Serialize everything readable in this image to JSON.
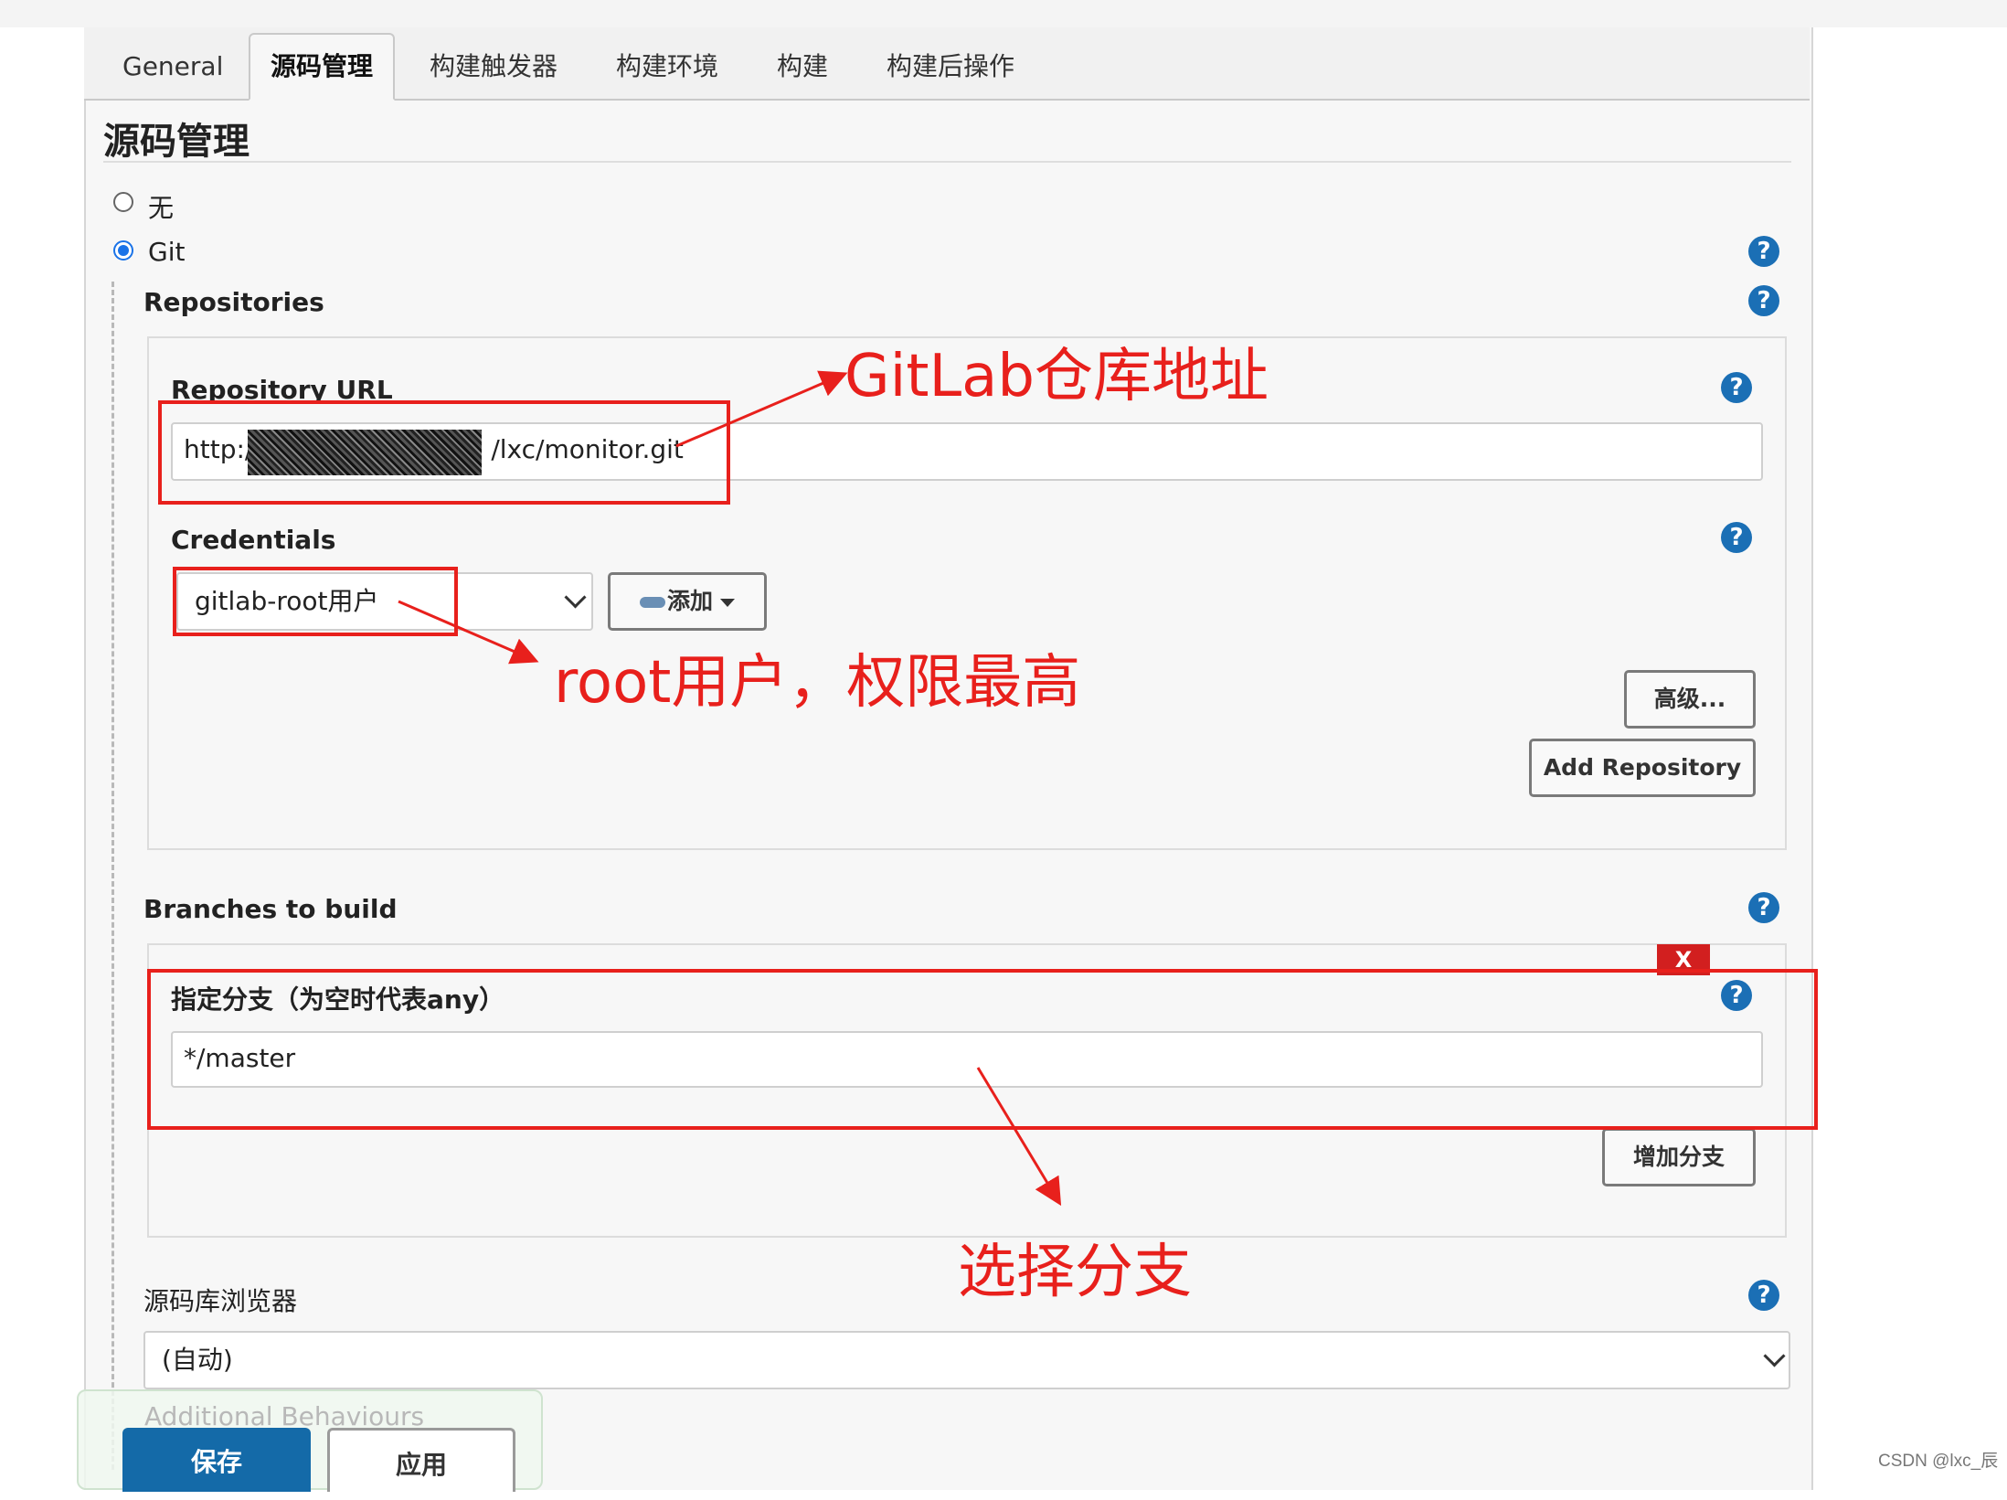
{
  "tabs": [
    "General",
    "源码管理",
    "构建触发器",
    "构建环境",
    "构建",
    "构建后操作"
  ],
  "section_title": "源码管理",
  "scm_options": {
    "none": "无",
    "git": "Git"
  },
  "repositories": {
    "label": "Repositories",
    "url_label": "Repository URL",
    "url_prefix": "http:/",
    "url_suffix": "/lxc/monitor.git",
    "credentials_label": "Credentials",
    "credentials_value": "gitlab-root用户",
    "add_button": "添加",
    "advanced_button": "高级...",
    "add_repository_button": "Add Repository"
  },
  "branches": {
    "label": "Branches to build",
    "delete": "X",
    "specifier_label": "指定分支（为空时代表any）",
    "specifier_value": "*/master",
    "add_branch_button": "增加分支"
  },
  "browser": {
    "label": "源码库浏览器",
    "value": "(自动)"
  },
  "additional_behaviours": "Additional Behaviours",
  "footer": {
    "save": "保存",
    "apply": "应用"
  },
  "annotations": {
    "gitlab": "GitLab仓库地址",
    "root": "root用户，权限最高",
    "branch": "选择分支"
  },
  "watermark": "CSDN @lxc_辰",
  "colors": {
    "annotation_red": "#e8201c",
    "help_blue": "#1b6fb5",
    "save_blue": "#146aa8"
  }
}
